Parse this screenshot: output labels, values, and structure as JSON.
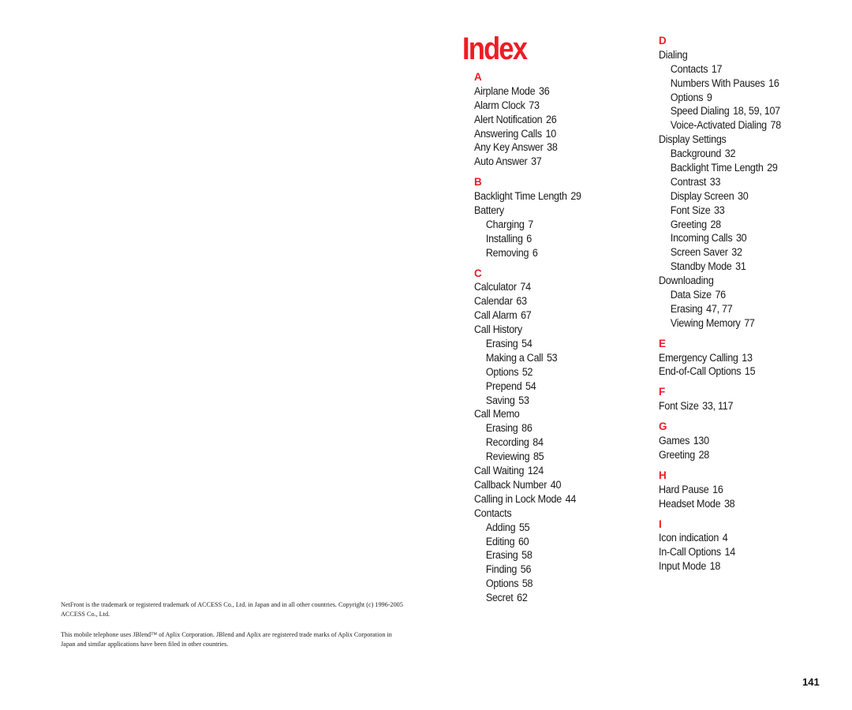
{
  "page": {
    "title": "Index",
    "page_number": "141",
    "colors": {
      "accent": "#ee1c24",
      "text": "#1a1a1a"
    }
  },
  "columns": [
    {
      "sections": [
        {
          "letter": "A",
          "entries": [
            {
              "term": "Airplane Mode",
              "pages": "36",
              "level": 0
            },
            {
              "term": "Alarm Clock",
              "pages": "73",
              "level": 0
            },
            {
              "term": "Alert Notification",
              "pages": "26",
              "level": 0
            },
            {
              "term": "Answering Calls",
              "pages": "10",
              "level": 0
            },
            {
              "term": "Any Key Answer",
              "pages": "38",
              "level": 0
            },
            {
              "term": "Auto Answer",
              "pages": "37",
              "level": 0
            }
          ]
        },
        {
          "letter": "B",
          "entries": [
            {
              "term": "Backlight Time Length",
              "pages": "29",
              "level": 0
            },
            {
              "term": "Battery",
              "pages": "",
              "level": 0
            },
            {
              "term": "Charging",
              "pages": "7",
              "level": 1
            },
            {
              "term": "Installing",
              "pages": "6",
              "level": 1
            },
            {
              "term": "Removing",
              "pages": "6",
              "level": 1
            }
          ]
        },
        {
          "letter": "C",
          "entries": [
            {
              "term": "Calculator",
              "pages": "74",
              "level": 0
            },
            {
              "term": "Calendar",
              "pages": "63",
              "level": 0
            },
            {
              "term": "Call Alarm",
              "pages": "67",
              "level": 0
            },
            {
              "term": "Call History",
              "pages": "",
              "level": 0
            },
            {
              "term": "Erasing",
              "pages": "54",
              "level": 1
            },
            {
              "term": "Making a Call",
              "pages": "53",
              "level": 1
            },
            {
              "term": "Options",
              "pages": "52",
              "level": 1
            },
            {
              "term": "Prepend",
              "pages": "54",
              "level": 1
            },
            {
              "term": "Saving",
              "pages": "53",
              "level": 1
            },
            {
              "term": "Call Memo",
              "pages": "",
              "level": 0
            },
            {
              "term": "Erasing",
              "pages": "86",
              "level": 1
            },
            {
              "term": "Recording",
              "pages": "84",
              "level": 1
            },
            {
              "term": "Reviewing",
              "pages": "85",
              "level": 1
            },
            {
              "term": "Call Waiting",
              "pages": "124",
              "level": 0
            },
            {
              "term": "Callback Number",
              "pages": "40",
              "level": 0
            },
            {
              "term": "Calling in Lock Mode",
              "pages": "44",
              "level": 0
            },
            {
              "term": "Contacts",
              "pages": "",
              "level": 0
            },
            {
              "term": "Adding",
              "pages": "55",
              "level": 1
            },
            {
              "term": "Editing",
              "pages": "60",
              "level": 1
            },
            {
              "term": "Erasing",
              "pages": "58",
              "level": 1
            },
            {
              "term": "Finding",
              "pages": "56",
              "level": 1
            },
            {
              "term": "Options",
              "pages": "58",
              "level": 1
            },
            {
              "term": "Secret",
              "pages": "62",
              "level": 1
            }
          ]
        }
      ]
    },
    {
      "sections": [
        {
          "letter": "D",
          "entries": [
            {
              "term": "Dialing",
              "pages": "",
              "level": 0
            },
            {
              "term": "Contacts",
              "pages": "17",
              "level": 1
            },
            {
              "term": "Numbers With Pauses",
              "pages": "16",
              "level": 1
            },
            {
              "term": "Options",
              "pages": "9",
              "level": 1
            },
            {
              "term": "Speed Dialing",
              "pages": "18, 59, 107",
              "level": 1
            },
            {
              "term": "Voice-Activated Dialing",
              "pages": "78",
              "level": 1
            },
            {
              "term": "Display Settings",
              "pages": "",
              "level": 0
            },
            {
              "term": "Background",
              "pages": "32",
              "level": 1
            },
            {
              "term": "Backlight Time Length",
              "pages": "29",
              "level": 1
            },
            {
              "term": "Contrast",
              "pages": "33",
              "level": 1
            },
            {
              "term": "Display Screen",
              "pages": "30",
              "level": 1
            },
            {
              "term": "Font Size",
              "pages": "33",
              "level": 1
            },
            {
              "term": "Greeting",
              "pages": "28",
              "level": 1
            },
            {
              "term": "Incoming Calls",
              "pages": "30",
              "level": 1
            },
            {
              "term": "Screen Saver",
              "pages": "32",
              "level": 1
            },
            {
              "term": "Standby Mode",
              "pages": "31",
              "level": 1
            },
            {
              "term": "Downloading",
              "pages": "",
              "level": 0
            },
            {
              "term": "Data Size",
              "pages": "76",
              "level": 1
            },
            {
              "term": "Erasing",
              "pages": "47, 77",
              "level": 1
            },
            {
              "term": "Viewing Memory",
              "pages": "77",
              "level": 1
            }
          ]
        },
        {
          "letter": "E",
          "entries": [
            {
              "term": "Emergency Calling",
              "pages": "13",
              "level": 0
            },
            {
              "term": "End-of-Call Options",
              "pages": "15",
              "level": 0
            }
          ]
        },
        {
          "letter": "F",
          "entries": [
            {
              "term": "Font Size",
              "pages": "33, 117",
              "level": 0
            }
          ]
        },
        {
          "letter": "G",
          "entries": [
            {
              "term": "Games",
              "pages": "130",
              "level": 0
            },
            {
              "term": "Greeting",
              "pages": "28",
              "level": 0
            }
          ]
        },
        {
          "letter": "H",
          "entries": [
            {
              "term": "Hard Pause",
              "pages": "16",
              "level": 0
            },
            {
              "term": "Headset Mode",
              "pages": "38",
              "level": 0
            }
          ]
        },
        {
          "letter": "I",
          "entries": [
            {
              "term": "Icon indication",
              "pages": "4",
              "level": 0
            },
            {
              "term": "In-Call Options",
              "pages": "14",
              "level": 0
            },
            {
              "term": "Input Mode",
              "pages": "18",
              "level": 0
            }
          ]
        }
      ]
    }
  ],
  "footnotes": [
    "NetFront is the trademark or registered trademark of ACCESS Co., Ltd. in Japan and in all other countries. Copyright (c) 1996-2005 ACCESS Co., Ltd.",
    "This mobile telephone uses JBlend™ of Aplix Corporation. JBlend and Aplix are registered trade marks of Aplix Corporation in Japan and similar applications have been filed in other countries."
  ]
}
